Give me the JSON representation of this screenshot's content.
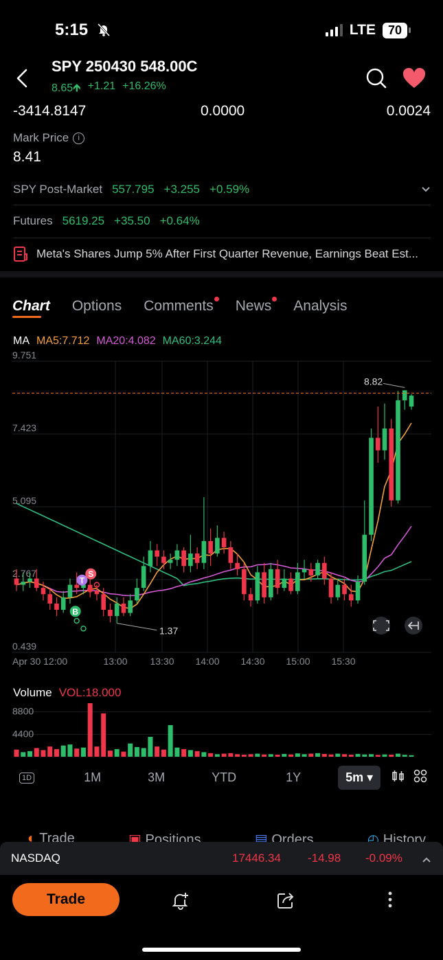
{
  "status": {
    "time": "5:15",
    "network": "LTE",
    "battery": "70"
  },
  "header": {
    "title": "SPY 250430 548.00C",
    "price": "8.65",
    "change": "+1.21",
    "change_pct": "+16.26%"
  },
  "stats": {
    "a": "-3414.8147",
    "b": "0.0000",
    "c": "0.0024"
  },
  "mark_price": {
    "label": "Mark Price",
    "value": "8.41"
  },
  "post_market": {
    "label": "SPY Post-Market",
    "price": "557.795",
    "change": "+3.255",
    "pct": "+0.59%"
  },
  "futures": {
    "label": "Futures",
    "price": "5619.25",
    "change": "+35.50",
    "pct": "+0.64%"
  },
  "news_headline": "Meta's Shares Jump 5% After First Quarter Revenue, Earnings Beat Est...",
  "tabs": [
    "Chart",
    "Options",
    "Comments",
    "News",
    "Analysis"
  ],
  "ma": {
    "label": "MA",
    "ma5": "MA5:7.712",
    "ma20": "MA20:4.082",
    "ma60": "MA60:3.244"
  },
  "colors": {
    "up": "#2ebd6b",
    "down": "#f0364a",
    "ma5": "#f5a13a",
    "ma20": "#d55ad6",
    "ma60": "#2fbf83",
    "accent": "#f26a1b"
  },
  "chart_data": {
    "type": "candlestick",
    "y_ticks": [
      "9.751",
      "7.423",
      "5.095",
      "2.767",
      "0.439"
    ],
    "x_ticks": [
      "Apr 30 12:00",
      "13:00",
      "13:30",
      "14:00",
      "14:30",
      "15:00",
      "15:30"
    ],
    "ylim": [
      0.439,
      9.751
    ],
    "high_label": "8.82",
    "low_label": "1.37",
    "markers": [
      "B",
      "S",
      "T"
    ],
    "candles": [
      [
        2.8,
        2.6,
        3.1,
        2.4
      ],
      [
        2.6,
        2.7,
        3.0,
        2.4
      ],
      [
        2.7,
        2.8,
        3.0,
        2.5
      ],
      [
        2.8,
        2.5,
        3.1,
        2.4
      ],
      [
        2.5,
        2.3,
        2.7,
        2.1
      ],
      [
        2.3,
        2.0,
        2.5,
        1.8
      ],
      [
        2.0,
        1.8,
        2.2,
        1.6
      ],
      [
        1.8,
        2.2,
        2.4,
        1.7
      ],
      [
        2.2,
        2.6,
        2.8,
        2.0
      ],
      [
        2.6,
        2.5,
        3.0,
        2.3
      ],
      [
        2.5,
        2.6,
        2.8,
        2.3
      ],
      [
        2.6,
        2.4,
        2.9,
        2.2
      ],
      [
        2.4,
        2.3,
        2.6,
        2.1
      ],
      [
        2.3,
        1.8,
        2.5,
        1.6
      ],
      [
        1.8,
        1.6,
        2.0,
        1.4
      ],
      [
        1.6,
        2.0,
        2.2,
        1.37
      ],
      [
        2.0,
        1.7,
        2.2,
        1.6
      ],
      [
        1.7,
        2.1,
        2.3,
        1.6
      ],
      [
        2.1,
        2.5,
        2.8,
        2.0
      ],
      [
        2.5,
        3.2,
        3.5,
        2.4
      ],
      [
        3.2,
        3.7,
        4.0,
        3.0
      ],
      [
        3.7,
        3.5,
        3.9,
        3.2
      ],
      [
        3.5,
        3.3,
        3.7,
        3.1
      ],
      [
        3.3,
        3.4,
        3.6,
        3.1
      ],
      [
        3.4,
        3.7,
        3.9,
        3.2
      ],
      [
        3.7,
        3.2,
        3.8,
        3.0
      ],
      [
        3.2,
        3.6,
        4.2,
        3.0
      ],
      [
        3.6,
        3.3,
        3.8,
        3.1
      ],
      [
        3.3,
        4.0,
        5.4,
        3.1
      ],
      [
        4.0,
        3.6,
        4.4,
        3.2
      ],
      [
        3.6,
        4.1,
        4.5,
        3.5
      ],
      [
        4.1,
        3.8,
        4.3,
        3.6
      ],
      [
        3.8,
        3.3,
        4.0,
        3.1
      ],
      [
        3.3,
        3.1,
        3.6,
        2.9
      ],
      [
        3.1,
        2.3,
        3.3,
        2.1
      ],
      [
        2.3,
        2.1,
        2.5,
        1.9
      ],
      [
        2.1,
        3.0,
        3.2,
        2.0
      ],
      [
        3.0,
        2.2,
        3.3,
        2.0
      ],
      [
        2.2,
        3.1,
        3.3,
        2.1
      ],
      [
        3.1,
        2.5,
        3.4,
        2.3
      ],
      [
        2.5,
        2.8,
        3.1,
        2.4
      ],
      [
        2.8,
        2.4,
        3.0,
        2.3
      ],
      [
        2.4,
        3.0,
        3.3,
        2.3
      ],
      [
        3.0,
        3.1,
        3.4,
        2.8
      ],
      [
        3.1,
        2.9,
        3.3,
        2.7
      ],
      [
        2.9,
        3.3,
        3.4,
        2.8
      ],
      [
        3.3,
        2.8,
        3.5,
        2.6
      ],
      [
        2.8,
        2.2,
        3.0,
        2.0
      ],
      [
        2.2,
        2.6,
        2.8,
        2.1
      ],
      [
        2.6,
        2.3,
        2.8,
        2.1
      ],
      [
        2.3,
        2.1,
        2.6,
        1.9
      ],
      [
        2.1,
        2.7,
        2.9,
        2.0
      ],
      [
        2.7,
        4.2,
        5.3,
        2.6
      ],
      [
        4.2,
        7.3,
        7.6,
        4.0
      ],
      [
        7.3,
        6.9,
        8.3,
        6.5
      ],
      [
        6.9,
        7.6,
        8.4,
        6.6
      ],
      [
        7.6,
        5.3,
        7.9,
        5.1
      ],
      [
        5.3,
        8.5,
        8.8,
        5.2
      ],
      [
        8.5,
        8.82,
        8.82,
        8.2
      ],
      [
        8.3,
        8.65,
        8.7,
        8.2
      ]
    ],
    "volume_ticks": [
      "8800",
      "4400"
    ],
    "volume_label": "Volume",
    "vol_value": "VOL:18.000",
    "volume_ylim": [
      0,
      10500
    ]
  },
  "periods": [
    "1D",
    "1M",
    "3M",
    "YTD",
    "1Y",
    "5m"
  ],
  "bottom_tabs": [
    "Trade",
    "Positions",
    "Orders",
    "History"
  ],
  "index_bar": {
    "name": "NASDAQ",
    "price": "17446.34",
    "change": "-14.98",
    "pct": "-0.09%"
  },
  "trade_button": "Trade"
}
